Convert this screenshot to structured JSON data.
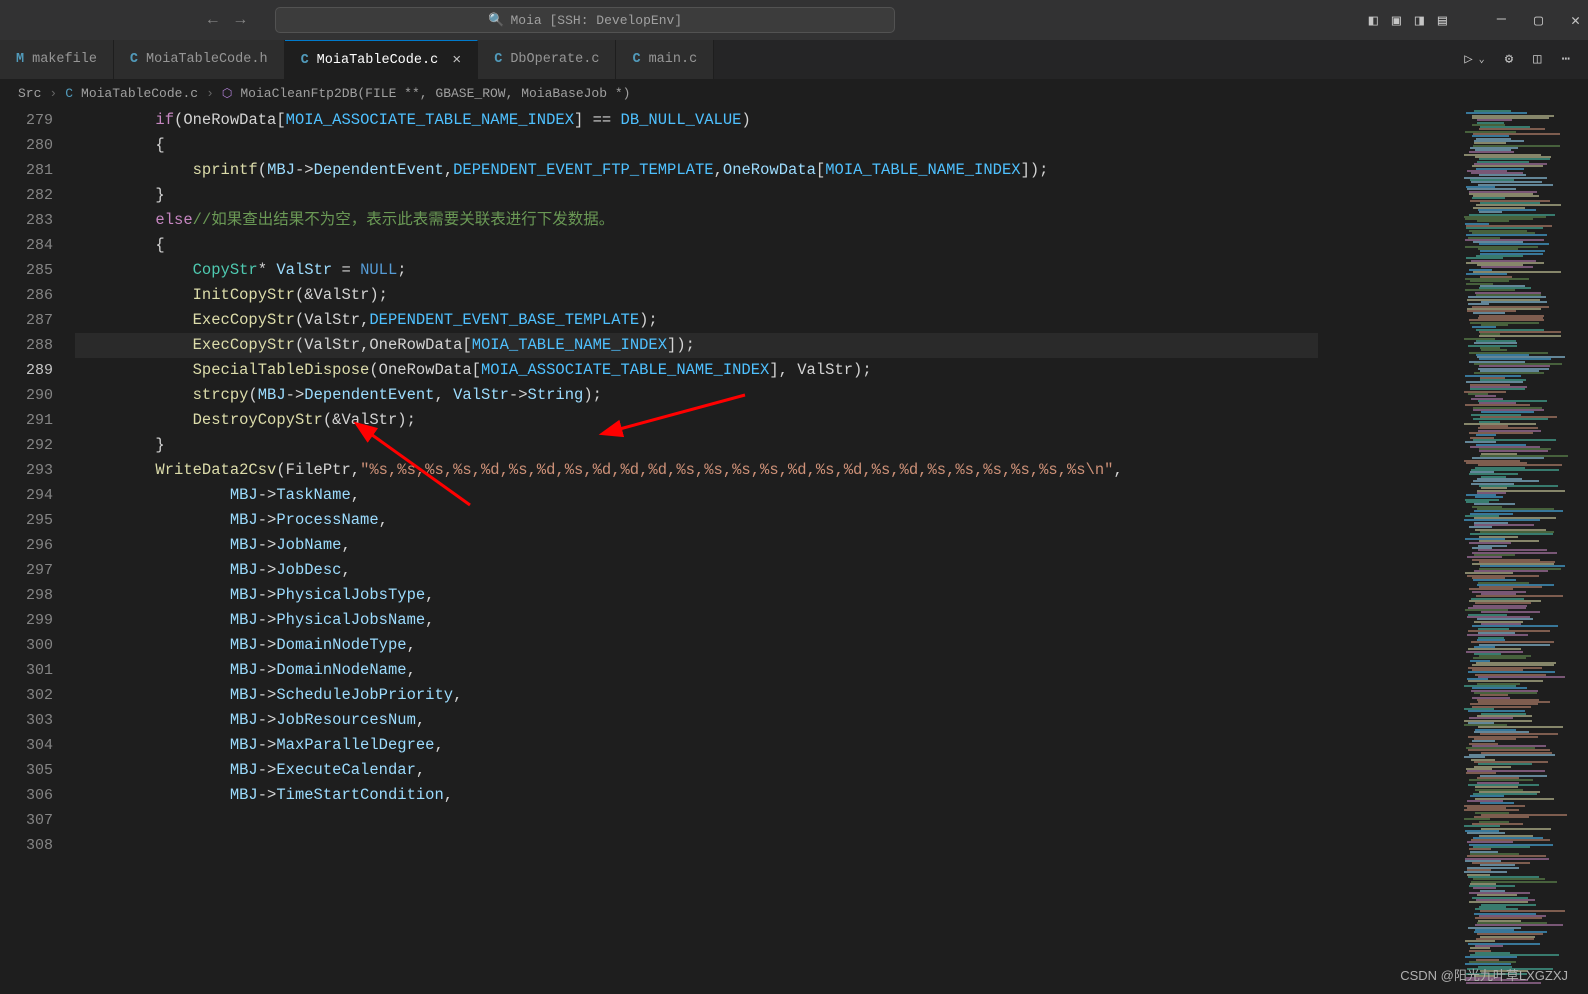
{
  "titlebar": {
    "search": "Moia [SSH: DevelopEnv]"
  },
  "tabs": {
    "items": [
      {
        "icon": "M",
        "icon_class": "m",
        "label": "makefile",
        "active": false,
        "close": false
      },
      {
        "icon": "C",
        "icon_class": "c",
        "label": "MoiaTableCode.h",
        "active": false,
        "close": false
      },
      {
        "icon": "C",
        "icon_class": "c",
        "label": "MoiaTableCode.c",
        "active": true,
        "close": true
      },
      {
        "icon": "C",
        "icon_class": "c",
        "label": "DbOperate.c",
        "active": false,
        "close": false
      },
      {
        "icon": "C",
        "icon_class": "c",
        "label": "main.c",
        "active": false,
        "close": false
      }
    ]
  },
  "breadcrumb": {
    "seg0": "Src",
    "seg1": "MoiaTableCode.c",
    "seg2": "MoiaCleanFtp2DB(FILE **, GBASE_ROW, MoiaBaseJob *)"
  },
  "gutter": {
    "start": 279,
    "end": 308,
    "active_line": 289
  },
  "code": {
    "line279_pre": "        ",
    "line279_if": "if",
    "line279_a": "(OneRowData[",
    "line279_c": "MOIA_ASSOCIATE_TABLE_NAME_INDEX",
    "line279_b": "] == ",
    "line279_c2": "DB_NULL_VALUE",
    "line279_e": ")",
    "brace_open": "{",
    "brace_close": "}",
    "line281_pre": "            ",
    "line281_fn": "sprintf",
    "line281_a": "(",
    "line281_id": "MBJ",
    "line281_arrow": "->",
    "line281_fld": "DependentEvent",
    "line281_cm1": ",",
    "line281_c1": "DEPENDENT_EVENT_FTP_TEMPLATE",
    "line281_cm2": ",",
    "line281_id2": "OneRowData",
    "line281_br": "[",
    "line281_c2": "MOIA_TABLE_NAME_INDEX",
    "line281_e": "]);",
    "line283_else": "else",
    "line283_cm": "//如果查出结果不为空，表示此表需要关联表进行下发数据。",
    "line285_pre": "            ",
    "line285_ty": "CopyStr",
    "line285_star": "* ",
    "line285_id": "ValStr",
    "line285_eq": " = ",
    "line285_null": "NULL",
    "line285_sc": ";",
    "line286_fn": "InitCopyStr",
    "line286_args": "(&ValStr);",
    "line288_fn": "ExecCopyStr",
    "line288_a": "(ValStr,",
    "line288_c": "DEPENDENT_EVENT_BASE_TEMPLATE",
    "line288_e": ");",
    "line289_fn": "ExecCopyStr",
    "line289_a": "(ValStr,OneRowData[",
    "line289_c": "MOIA_TABLE_NAME_INDEX",
    "line289_e": "]);",
    "line290_fn": "SpecialTableDispose",
    "line290_a": "(OneRowData[",
    "line290_c": "MOIA_ASSOCIATE_TABLE_NAME_INDEX",
    "line290_e": "], ValStr);",
    "line291_fn": "strcpy",
    "line291_a": "(",
    "line291_id": "MBJ",
    "line291_arrow": "->",
    "line291_f1": "DependentEvent",
    "line291_cm": ", ",
    "line291_id2": "ValStr",
    "line291_arrow2": "->",
    "line291_f2": "String",
    "line291_e": ");",
    "line293_fn": "DestroyCopyStr",
    "line293_args": "(&ValStr);",
    "line295_fn": "WriteData2Csv",
    "line295_a": "(FilePtr,",
    "line295_str": "\"%s,%s,%s,%s,%d,%s,%d,%s,%d,%d,%d,%s,%s,%s,%s,%d,%s,%d,%s,%d,%s,%s,%s,%s,%s,%s\\n\"",
    "line295_e": ",",
    "mbj": "MBJ",
    "arrow": "->",
    "fields": [
      "TaskName",
      "ProcessName",
      "JobName",
      "JobDesc",
      "PhysicalJobsType",
      "PhysicalJobsName",
      "DomainNodeType",
      "DomainNodeName",
      "ScheduleJobPriority",
      "JobResourcesNum",
      "MaxParallelDegree",
      "ExecuteCalendar",
      "TimeStartCondition"
    ]
  },
  "watermark": "CSDN @阳光九叶草LXGZXJ"
}
